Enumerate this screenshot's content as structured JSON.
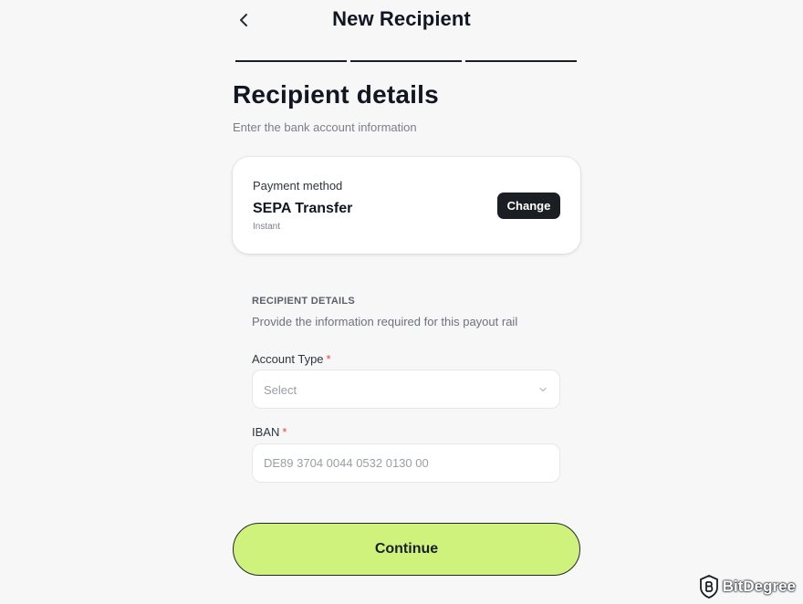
{
  "header": {
    "title": "New Recipient",
    "back_icon": "chevron-left-icon"
  },
  "steps": {
    "count": 3
  },
  "section": {
    "title": "Recipient details",
    "subtitle": "Enter the bank account information"
  },
  "payment_method": {
    "label": "Payment method",
    "name": "SEPA Transfer",
    "speed": "Instant",
    "change_label": "Change"
  },
  "recipient_details": {
    "heading": "RECIPIENT DETAILS",
    "description": "Provide the information required for this payout rail",
    "account_type": {
      "label": "Account Type",
      "required_mark": "*",
      "value": "Select"
    },
    "iban": {
      "label": "IBAN",
      "required_mark": "*",
      "placeholder": "DE89 3704 0044 0532 0130 00",
      "value": ""
    }
  },
  "actions": {
    "continue_label": "Continue"
  },
  "watermark": {
    "text": "BitDegree"
  },
  "colors": {
    "accent": "#cff27d",
    "dark": "#1b1f24",
    "required": "#e5484d",
    "background": "#f7f7f8"
  }
}
